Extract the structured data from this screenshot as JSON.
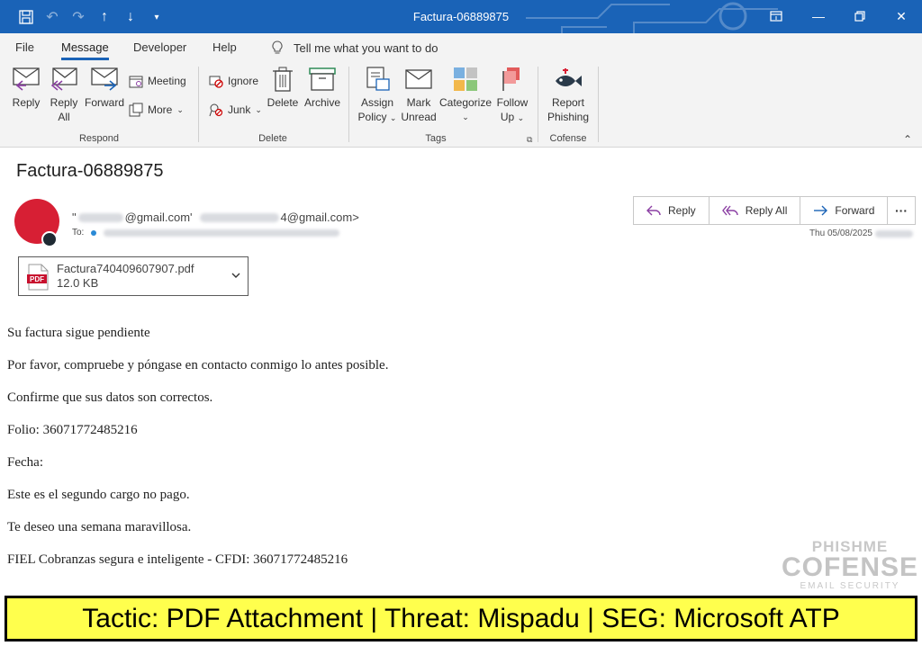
{
  "titlebar": {
    "title": "Factura-06889875",
    "bg": "#1a63b7"
  },
  "menu": {
    "tabs": [
      "File",
      "Message",
      "Developer",
      "Help"
    ],
    "active": "Message",
    "tell_me": "Tell me what you want to do"
  },
  "ribbon": {
    "respond": {
      "label": "Respond",
      "reply": "Reply",
      "reply_all_1": "Reply",
      "reply_all_2": "All",
      "forward": "Forward",
      "meeting": "Meeting",
      "more": "More"
    },
    "delete": {
      "label": "Delete",
      "ignore": "Ignore",
      "junk": "Junk",
      "delete": "Delete",
      "archive": "Archive"
    },
    "tags": {
      "label": "Tags",
      "assign_1": "Assign",
      "assign_2": "Policy",
      "mark_1": "Mark",
      "mark_2": "Unread",
      "categorize": "Categorize",
      "follow_1": "Follow",
      "follow_2": "Up"
    },
    "cofense": {
      "label": "Cofense",
      "report_1": "Report",
      "report_2": "Phishing"
    }
  },
  "email": {
    "subject": "Factura-06889875",
    "sender_quote": "\"",
    "sender_name_suffix": "@gmail.com'",
    "sender_addr_suffix": "4@gmail.com>",
    "to_label": "To:",
    "date": "Thu 05/08/2025",
    "actions": {
      "reply": "Reply",
      "reply_all": "Reply All",
      "forward": "Forward",
      "more": "···"
    },
    "avatar_color": "#d71f34"
  },
  "attachment": {
    "name": "Factura740409607907.pdf",
    "size": "12.0 KB",
    "icon_label": "PDF"
  },
  "body": {
    "lines": [
      "Su factura sigue pendiente",
      "Por favor, compruebe y póngase en contacto conmigo lo antes posible.",
      "Confirme que sus datos son correctos.",
      "Folio: 36071772485216",
      "Fecha:",
      "Este es el segundo cargo no pago.",
      "Te deseo una semana maravillosa.",
      "FIEL Cobranzas segura e inteligente - CFDI: 36071772485216"
    ]
  },
  "watermark": {
    "top": "PHISHME",
    "brand": "COFENSE",
    "sub": "EMAIL SECURITY"
  },
  "banner": {
    "text": "Tactic: PDF Attachment | Threat: Mispadu | SEG: Microsoft ATP",
    "bg": "#ffff4d"
  }
}
